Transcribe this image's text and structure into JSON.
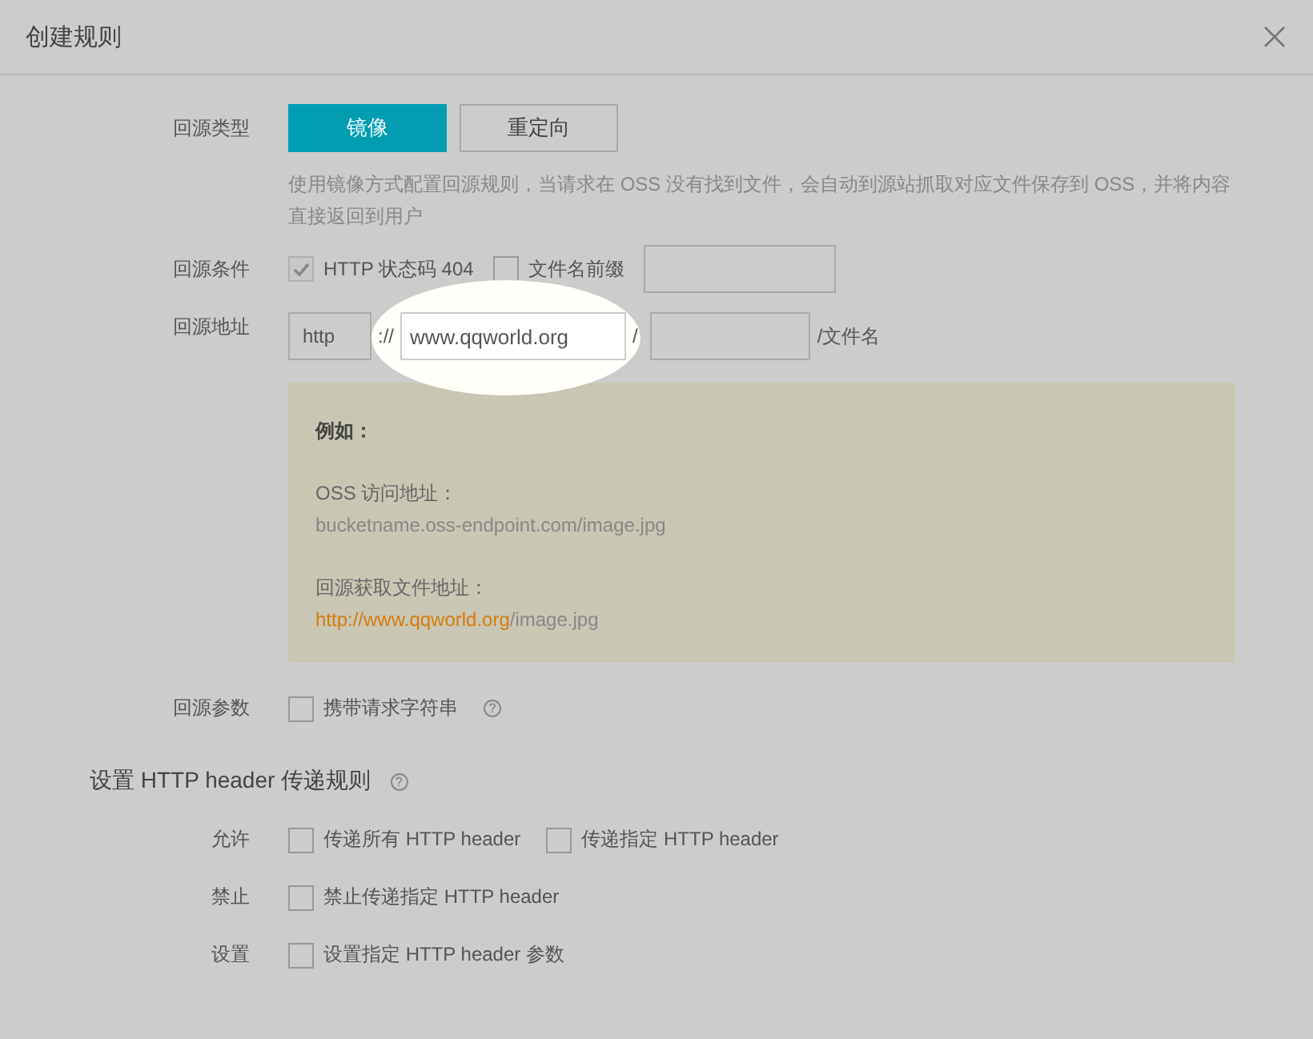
{
  "dialog": {
    "title": "创建规则"
  },
  "source_type": {
    "label": "回源类型",
    "options": [
      {
        "label": "镜像",
        "selected": true
      },
      {
        "label": "重定向",
        "selected": false
      }
    ],
    "description": "使用镜像方式配置回源规则，当请求在 OSS 没有找到文件，会自动到源站抓取对应文件保存到 OSS，并将内容直接返回到用户"
  },
  "condition": {
    "label": "回源条件",
    "options": [
      {
        "label": "HTTP 状态码  404",
        "checked": true,
        "disabled": true
      },
      {
        "label": "文件名前缀",
        "checked": false,
        "disabled": false
      }
    ]
  },
  "address": {
    "label": "回源地址",
    "protocol": "http",
    "separator": "://",
    "domain": "www.qqworld.org",
    "domain_highlighted": true,
    "slash": "/",
    "suffix": "/文件名"
  },
  "example": {
    "heading": "例如：",
    "oss_label": "OSS 访问地址：",
    "oss_url": "bucketname.oss-endpoint.com/image.jpg",
    "origin_label": "回源获取文件地址：",
    "origin_link": "http://www.qqworld.org",
    "origin_rest": "/image.jpg"
  },
  "params": {
    "label": "回源参数",
    "option": {
      "label": "携带请求字符串",
      "checked": false
    },
    "help": "?"
  },
  "header_section": {
    "title": "设置 HTTP header 传递规则",
    "help": "?",
    "rows": [
      {
        "label": "允许",
        "options": [
          {
            "label": "传递所有 HTTP header",
            "checked": false
          },
          {
            "label": "传递指定 HTTP header",
            "checked": false
          }
        ]
      },
      {
        "label": "禁止",
        "options": [
          {
            "label": "禁止传递指定 HTTP header",
            "checked": false
          }
        ]
      },
      {
        "label": "设置",
        "options": [
          {
            "label": "设置指定 HTTP header 参数",
            "checked": false
          }
        ]
      }
    ]
  }
}
